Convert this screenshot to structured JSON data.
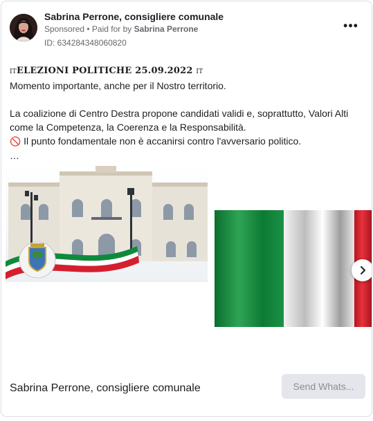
{
  "header": {
    "page_name": "Sabrina Perrone, consigliere comunale",
    "sponsored_label": "Sponsored",
    "separator": " • ",
    "paid_for_label": "Paid for by",
    "paid_for_name": "Sabrina Perrone",
    "ad_id": "ID: 634284348060820",
    "more_label": "•••"
  },
  "post": {
    "headline_flag_left": "IT",
    "headline": "ELEZIONI POLITICHE 25.09.2022",
    "headline_flag_right": "IT",
    "line_2": "Momento importante, anche per il Nostro territorio.",
    "paragraph_2": "La coalizione di Centro Destra propone candidati validi e, soprattutto, Valori Alti come la Competenza, la Coerenza e la Responsabilità.",
    "line_4_icon": "🚫",
    "line_4": " Il punto fondamentale non è accanirsi contro l'avversario politico.",
    "ellipsis": "…"
  },
  "carousel": {
    "image_1": "town-hall-with-coat-of-arms-image",
    "image_2": "italian-flag-image",
    "next_icon": "chevron-right-icon"
  },
  "footer": {
    "page_name": "Sabrina Perrone, consigliere comunale",
    "cta_label": "Send Whats..."
  },
  "colors": {
    "text": "#1c1e21",
    "muted": "#65676b",
    "button_bg": "#e4e6eb",
    "button_text": "#8a8d91",
    "flag_green": "#0f8a3c",
    "flag_red": "#d41f2f"
  }
}
